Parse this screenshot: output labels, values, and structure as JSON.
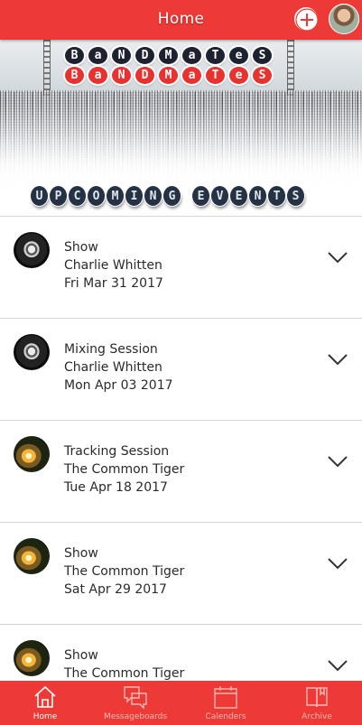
{
  "header": {
    "title": "Home",
    "add_icon": "plus-circle-icon",
    "profile_avatar": "user-avatar"
  },
  "hero": {
    "brand_top": "BaNDMaTeS",
    "brand_bottom": "BaNDMaTeS",
    "section_title": "UPCOMING EVENTS"
  },
  "events": [
    {
      "type": "Show",
      "artist": "Charlie Whitten",
      "date": "Fri Mar 31 2017"
    },
    {
      "type": "Mixing Session",
      "artist": "Charlie Whitten",
      "date": "Mon Apr 03 2017"
    },
    {
      "type": "Tracking Session",
      "artist": "The Common Tiger",
      "date": "Tue Apr 18 2017"
    },
    {
      "type": "Show",
      "artist": "The Common Tiger",
      "date": "Sat Apr 29 2017"
    },
    {
      "type": "Show",
      "artist": "The Common Tiger",
      "date": ""
    }
  ],
  "tabs": [
    {
      "label": "Home",
      "icon": "home-icon",
      "active": true
    },
    {
      "label": "Messageboards",
      "icon": "chat-bubbles-icon",
      "active": false
    },
    {
      "label": "Calenders",
      "icon": "calendar-icon",
      "active": false
    },
    {
      "label": "Archive",
      "icon": "book-icon",
      "active": false
    }
  ],
  "colors": {
    "accent": "#ee3a36",
    "badge_dark": "#243244"
  }
}
